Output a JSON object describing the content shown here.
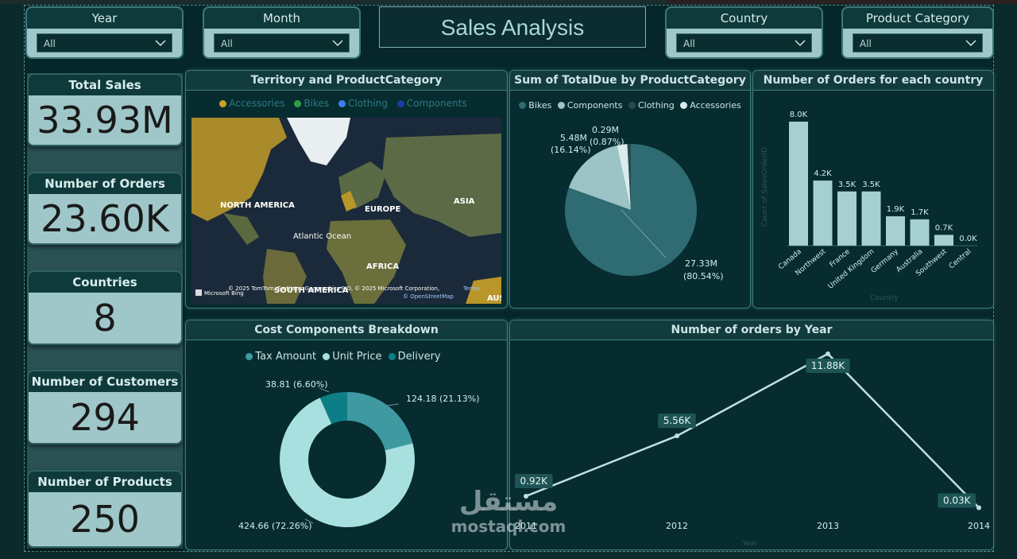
{
  "app_title": "Sales Analysis",
  "slicers": [
    {
      "label": "Year",
      "value": "All"
    },
    {
      "label": "Month",
      "value": "All"
    },
    {
      "label": "Country",
      "value": "All"
    },
    {
      "label": "Product Category",
      "value": "All"
    }
  ],
  "kpis": [
    {
      "label": "Total Sales",
      "value": "33.93M"
    },
    {
      "label": "Number of Orders",
      "value": "23.60K"
    },
    {
      "label": "Countries",
      "value": "8"
    },
    {
      "label": "Number of Customers",
      "value": "294"
    },
    {
      "label": "Number of Products",
      "value": "250"
    }
  ],
  "map_panel": {
    "title": "Territory and ProductCategory",
    "legend": [
      {
        "label": "Accessories",
        "color": "#c9a227"
      },
      {
        "label": "Bikes",
        "color": "#2ea043"
      },
      {
        "label": "Clothing",
        "color": "#3b82f6"
      },
      {
        "label": "Components",
        "color": "#1e3aa8"
      }
    ],
    "labels": [
      "NORTH AMERICA",
      "EUROPE",
      "ASIA",
      "Atlantic Ocean",
      "AFRICA",
      "SOUTH AMERICA",
      "AUS"
    ],
    "attribution": "© 2025 TomTom, Earthstar Geographics SIO, © 2025 Microsoft Corporation,",
    "terms": "Terms",
    "osm": "© OpenStreetMap",
    "brand": "Microsoft Bing"
  },
  "pie_panel": {
    "title": "Sum of TotalDue by ProductCategory",
    "legend": [
      {
        "label": "Bikes",
        "color": "#2e6b72"
      },
      {
        "label": "Components",
        "color": "#9cc4c6"
      },
      {
        "label": "Clothing",
        "color": "#2a4a4e"
      },
      {
        "label": "Accessories",
        "color": "#d8ecec"
      }
    ],
    "slice_labels": [
      {
        "value": "27.33M",
        "pct": "(80.54%)"
      },
      {
        "value": "5.48M",
        "pct": "(16.14%)"
      },
      {
        "value": "0.29M",
        "pct": "(0.87%)"
      }
    ]
  },
  "bar_panel": {
    "title": "Number of Orders for each country",
    "ylabel": "Count of SalesOrderID",
    "xlabel": "Country"
  },
  "donut_panel": {
    "title": "Cost Components Breakdown",
    "legend": [
      {
        "label": "Tax Amount",
        "color": "#3e9aa0"
      },
      {
        "label": "Unit Price",
        "color": "#a8e0e0"
      },
      {
        "label": "Delivery",
        "color": "#0e7e86"
      }
    ],
    "slice_labels": [
      "124.18 (21.13%)",
      "424.66 (72.26%)",
      "38.81 (6.60%)"
    ]
  },
  "line_panel": {
    "title": "Number of orders by Year",
    "xlabel": "Year"
  },
  "watermark": {
    "arabic": "مستقل",
    "latin": "mostaql.com"
  },
  "chart_data": [
    {
      "type": "pie",
      "title": "Sum of TotalDue by ProductCategory",
      "categories": [
        "Bikes",
        "Components",
        "Clothing",
        "Accessories"
      ],
      "values": [
        27.33,
        5.48,
        0.29,
        0.86
      ],
      "unit": "M",
      "colors": [
        "#2e6b72",
        "#9cc4c6",
        "#2a4a4e",
        "#d8ecec"
      ]
    },
    {
      "type": "bar",
      "title": "Number of Orders for each country",
      "categories": [
        "Canada",
        "Northwest",
        "France",
        "United Kingdom",
        "Germany",
        "Australia",
        "Southwest",
        "Central"
      ],
      "values": [
        8.0,
        4.2,
        3.5,
        3.5,
        1.9,
        1.7,
        0.7,
        0.0
      ],
      "data_labels": [
        "8.0K",
        "4.2K",
        "3.5K",
        "3.5K",
        "1.9K",
        "1.7K",
        "0.7K",
        "0.0K"
      ],
      "ylabel": "Count of SalesOrderID",
      "xlabel": "Country",
      "ylim": [
        0,
        8.0
      ],
      "color": "#a6cfd2"
    },
    {
      "type": "pie",
      "title": "Cost Components Breakdown",
      "categories": [
        "Tax Amount",
        "Unit Price",
        "Delivery"
      ],
      "values": [
        124.18,
        424.66,
        38.81
      ],
      "colors": [
        "#3e9aa0",
        "#a8e0e0",
        "#0e7e86"
      ]
    },
    {
      "type": "line",
      "title": "Number of orders by Year",
      "x": [
        "2011",
        "2012",
        "2013",
        "2014"
      ],
      "values": [
        0.92,
        5.56,
        11.88,
        0.03
      ],
      "data_labels": [
        "0.92K",
        "5.56K",
        "11.88K",
        "0.03K"
      ],
      "xlabel": "Year",
      "ylim": [
        0,
        12
      ],
      "color": "#bfe1e2"
    }
  ]
}
